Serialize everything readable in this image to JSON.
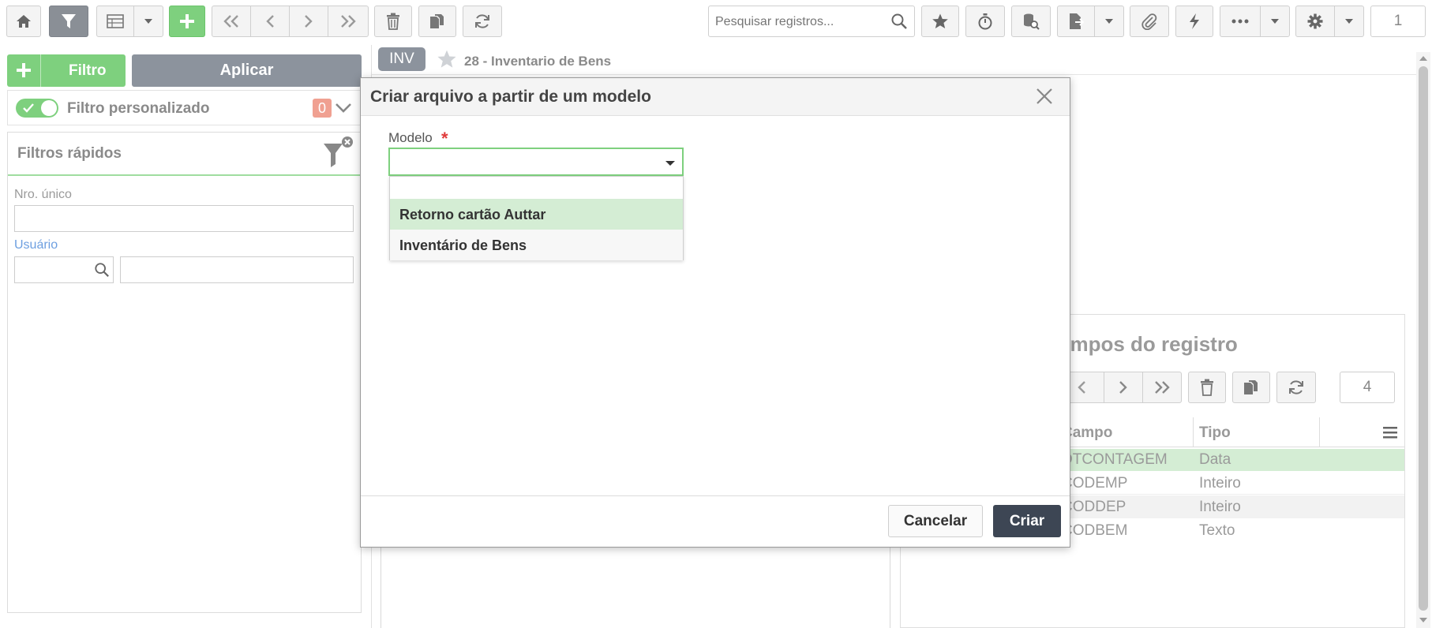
{
  "toolbar": {
    "search_placeholder": "Pesquisar registros...",
    "page_number": "1"
  },
  "filter_panel": {
    "add_filter_label": "Filtro",
    "apply_label": "Aplicar",
    "custom_filter_label": "Filtro personalizado",
    "custom_filter_count": "0",
    "quick_filters_title": "Filtros rápidos",
    "field_nro_unico_label": "Nro. único",
    "field_usuario_label": "Usuário"
  },
  "record_header": {
    "badge": "INV",
    "title": "28 - Inventario de Bens"
  },
  "fields_panel": {
    "title": "ampos do registro",
    "page_number": "4",
    "columns": [
      "Campo",
      "Tipo"
    ],
    "rows": [
      {
        "campo": "DTCONTAGEM",
        "tipo": "Data"
      },
      {
        "campo": "CODEMP",
        "tipo": "Inteiro"
      },
      {
        "campo": "CODDEP",
        "tipo": "Inteiro"
      },
      {
        "campo": "CODBEM",
        "tipo": "Texto"
      }
    ]
  },
  "dialog": {
    "title": "Criar arquivo a partir de um modelo",
    "model_label": "Modelo",
    "required_mark": "*",
    "options": [
      {
        "label": ""
      },
      {
        "label": "Retorno cartão Auttar"
      },
      {
        "label": "Inventário de Bens"
      }
    ],
    "cancel_label": "Cancelar",
    "create_label": "Criar"
  },
  "colors": {
    "accent_green": "#7ed07e",
    "dark_button": "#3d4654",
    "badge_gray": "#8c939d",
    "highlight_row": "#d4edd4",
    "required_red": "#e03a3a",
    "link_blue": "#6d9fe0"
  }
}
